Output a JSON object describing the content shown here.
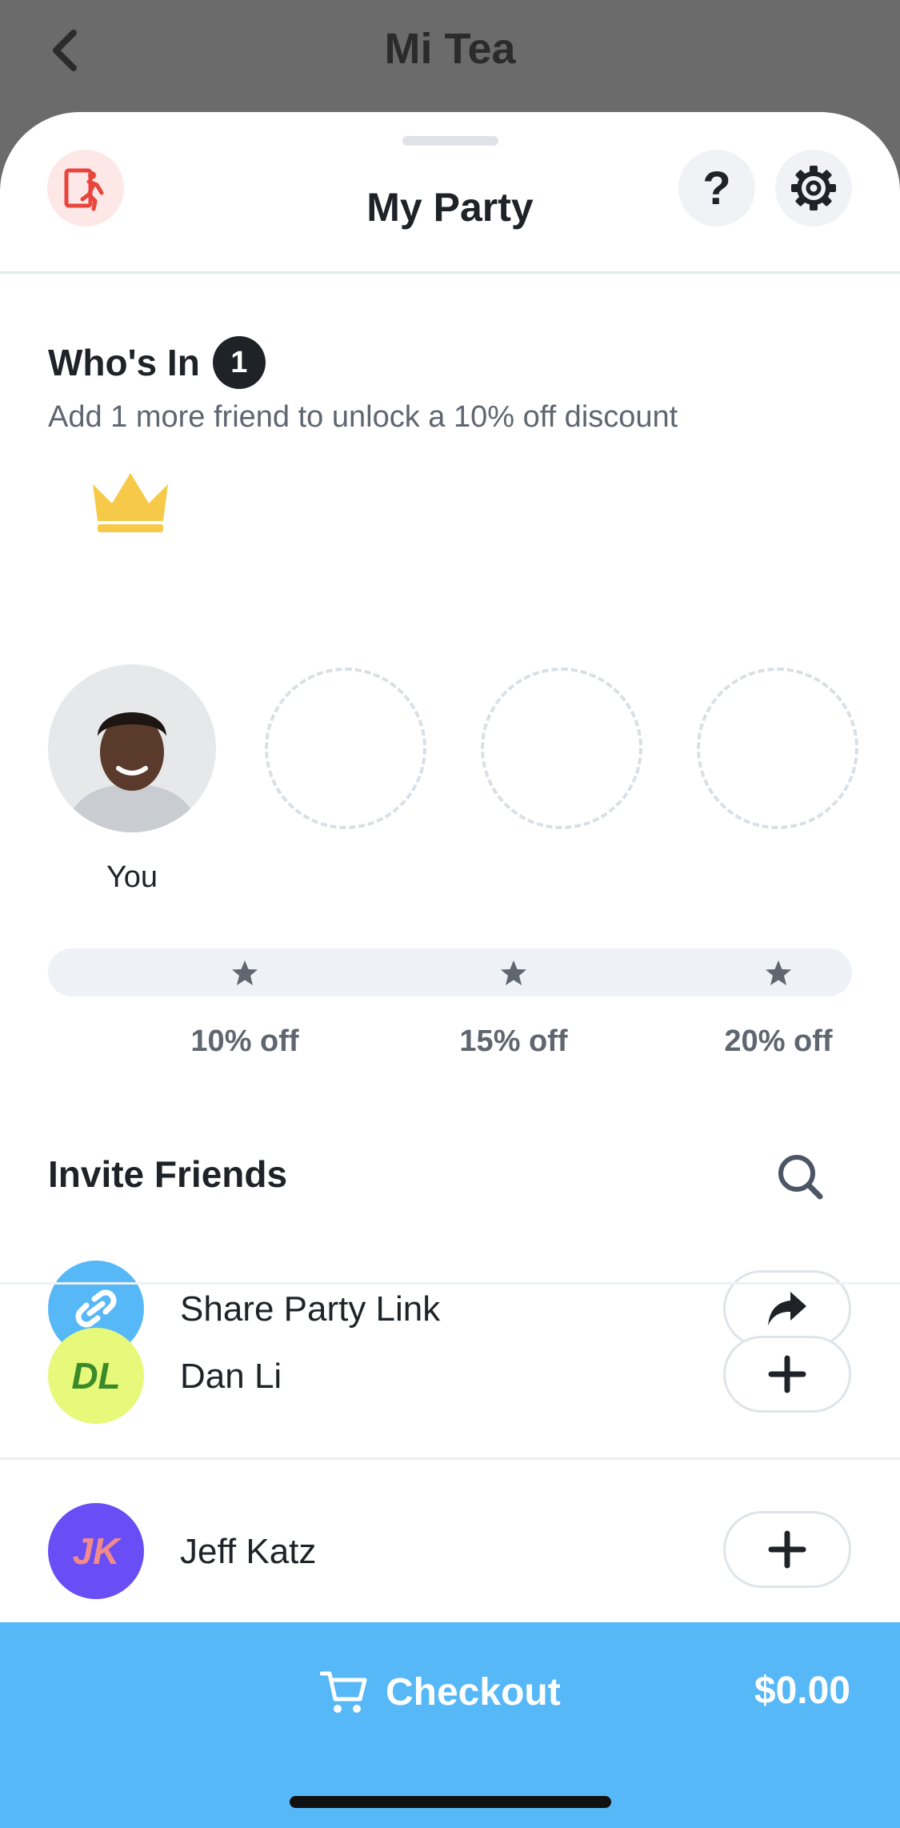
{
  "topbar": {
    "title": "Mi Tea",
    "back_icon": "chevron-left-icon"
  },
  "sheet": {
    "title": "My Party",
    "exit_icon": "exit-door-icon",
    "help_label": "?",
    "settings_icon": "gear-icon"
  },
  "party": {
    "heading": "Who's In",
    "count": "1",
    "subtitle": "Add 1 more friend to unlock a 10% off discount",
    "members": [
      {
        "label": "You",
        "is_host": true
      }
    ],
    "empty_slots": 3
  },
  "discounts": {
    "tiers": [
      {
        "label": "10% off"
      },
      {
        "label": "15% off"
      },
      {
        "label": "20% off"
      }
    ],
    "progress": 0
  },
  "invite": {
    "heading": "Invite Friends",
    "search_icon": "search-icon",
    "rows": [
      {
        "label": "Share Party Link",
        "action_icon": "share-arrow-icon",
        "avatar_color": "#57b8f7"
      },
      {
        "label": "Dan Li",
        "initials": "DL",
        "action_icon": "plus-icon",
        "avatar_color": "#e6f97a",
        "initials_color": "#3a8a2a"
      },
      {
        "label": "Jeff Katz",
        "initials": "JK",
        "action_icon": "plus-icon",
        "avatar_color": "#6a4ef5",
        "initials_color": "#f28a8a"
      }
    ]
  },
  "checkout": {
    "label": "Checkout",
    "total": "$0.00",
    "cart_icon": "cart-icon",
    "bar_color": "#57b8f7"
  }
}
